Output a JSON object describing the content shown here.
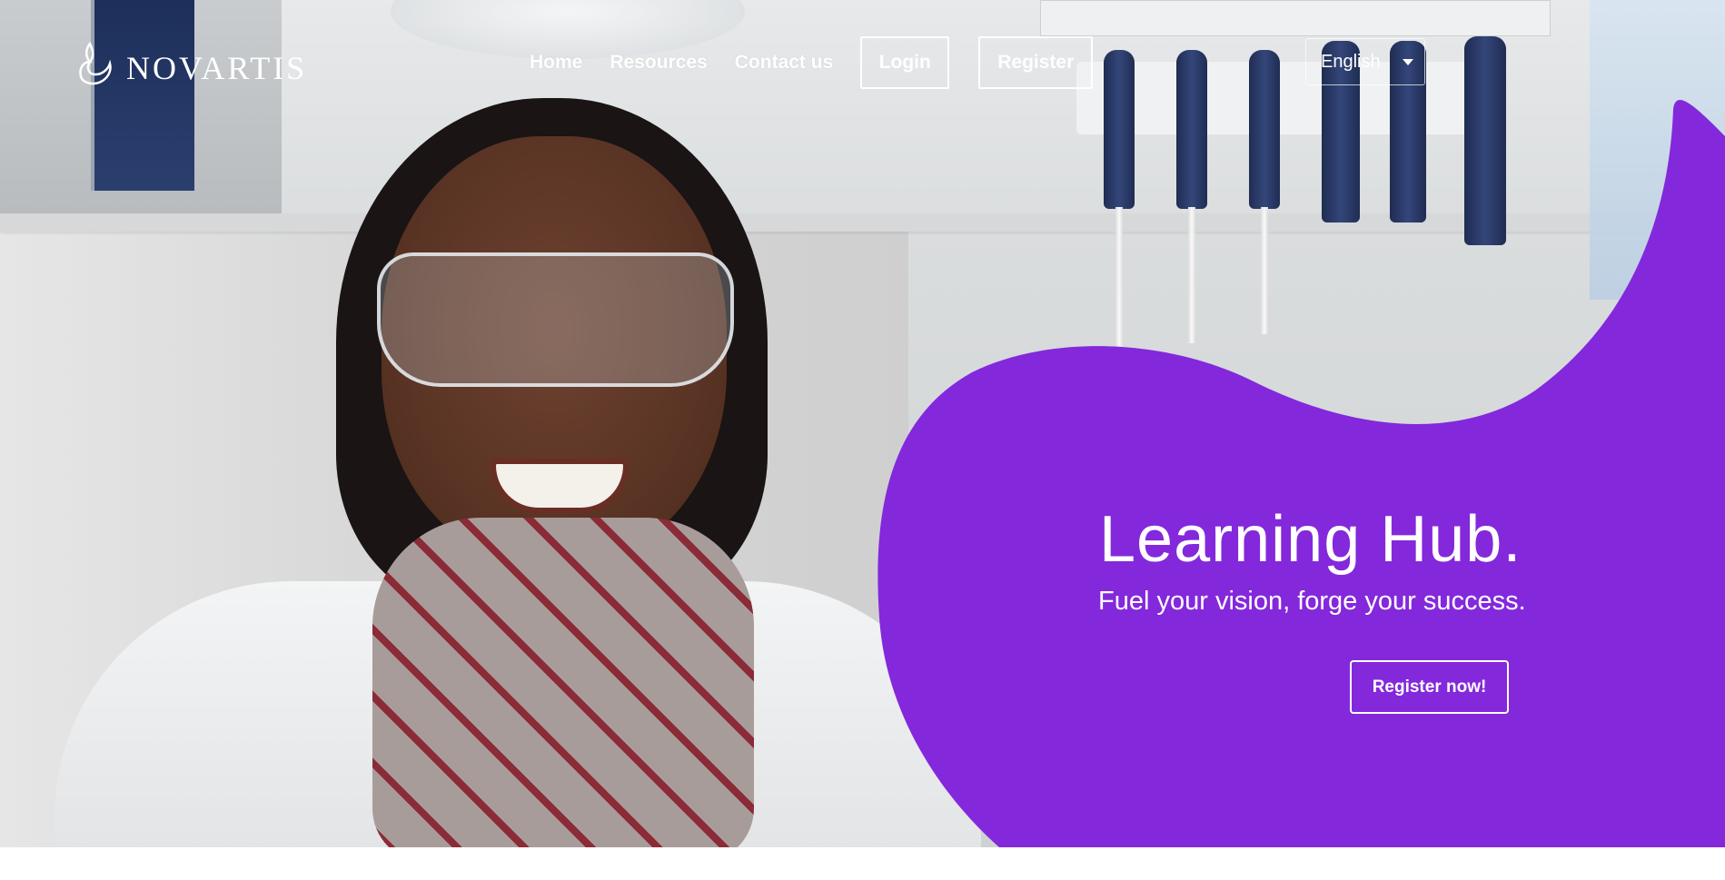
{
  "brand": {
    "logo_text": "NOVARTIS",
    "logo_icon": "novartis-flame-icon"
  },
  "nav": {
    "links": [
      {
        "label": "Home"
      },
      {
        "label": "Resources"
      },
      {
        "label": "Contact us"
      }
    ],
    "login_label": "Login",
    "register_label": "Register",
    "language": {
      "selected": "English",
      "caret_icon": "caret-down-icon"
    }
  },
  "hero": {
    "title": "Learning Hub.",
    "subtitle": "Fuel your vision, forge your success.",
    "cta_label": "Register now!",
    "image": "scientist-in-lab-photo"
  },
  "colors": {
    "accent_purple": "#8428dc",
    "text_on_accent": "#ffffff",
    "page_background": "#ffffff"
  }
}
